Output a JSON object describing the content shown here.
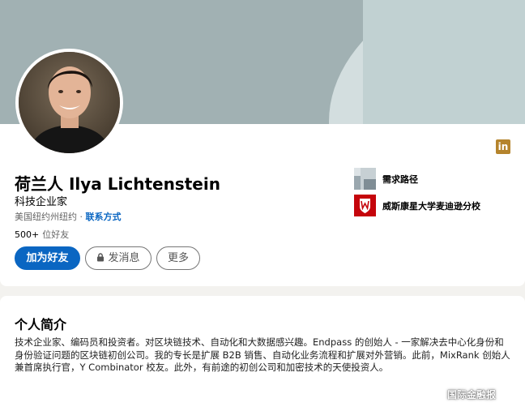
{
  "profile": {
    "name": "荷兰人 Ilya Lichtenstein",
    "headline": "科技企业家",
    "location": "美国纽约州纽约",
    "location_separator": "·",
    "contact_info": "联系方式",
    "connections_count": "500+",
    "connections_unit": "位好友",
    "linkedin_badge": "in"
  },
  "actions": {
    "connect_label": "加为好友",
    "message_label": "发消息",
    "more_label": "更多"
  },
  "sidebar": {
    "company": "需求路径",
    "school": "威斯康星大学麦迪逊分校"
  },
  "about": {
    "title": "个人简介",
    "text": "技术企业家、编码员和投资者。对区块链技术、自动化和大数据感兴趣。Endpass 的创始人 - 一家解决去中心化身份和身份验证问题的区块链初创公司。我的专长是扩展 B2B 销售、自动化业务流程和扩展对外营销。此前，MixRank 创始人兼首席执行官，Y Combinator 校友。此外，有前途的初创公司和加密技术的天使投资人。"
  },
  "watermark": "国际金融报",
  "colors": {
    "accent": "#0a66c2",
    "linkedin_badge": "#b5842c",
    "school_red": "#c5050c",
    "banner": "#a1b1b3"
  }
}
